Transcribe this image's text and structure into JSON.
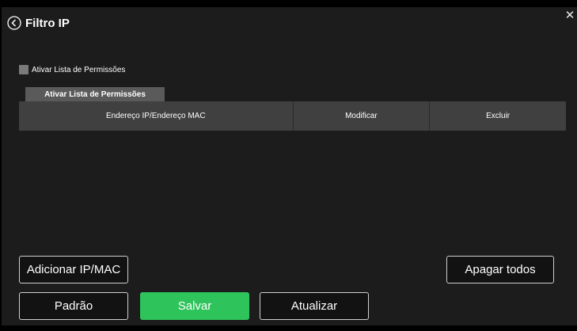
{
  "dialog": {
    "title": "Filtro IP",
    "close_glyph": "✕",
    "back_icon": "circle-chevron-left-icon"
  },
  "permissions": {
    "checkbox_label": "Ativar Lista de Permissões",
    "checked": false,
    "tab_label": "Ativar Lista de Permissões"
  },
  "table": {
    "columns": [
      "Endereço IP/Endereço MAC",
      "Modificar",
      "Excluir"
    ],
    "rows": []
  },
  "buttons": {
    "add": "Adicionar IP/MAC",
    "clear_all": "Apagar todos",
    "default": "Padrão",
    "save": "Salvar",
    "refresh": "Atualizar"
  },
  "colors": {
    "background": "#1c1c1c",
    "save_button": "#2ec45b",
    "header_row": "#404040",
    "tab": "#5a5a5a"
  }
}
